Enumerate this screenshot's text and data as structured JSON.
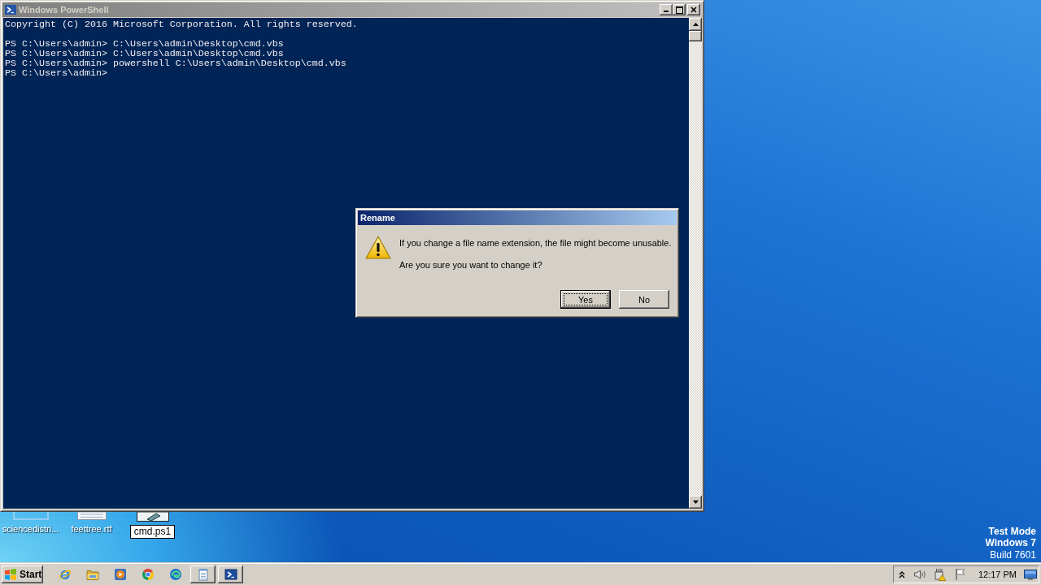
{
  "window": {
    "title": "Windows PowerShell",
    "active": false,
    "console": {
      "header": "Copyright (C) 2016 Microsoft Corporation. All rights reserved.",
      "lines": [
        "PS C:\\Users\\admin> C:\\Users\\admin\\Desktop\\cmd.vbs",
        "PS C:\\Users\\admin> C:\\Users\\admin\\Desktop\\cmd.vbs",
        "PS C:\\Users\\admin> powershell C:\\Users\\admin\\Desktop\\cmd.vbs",
        "PS C:\\Users\\admin>"
      ]
    }
  },
  "dialog": {
    "title": "Rename",
    "active": true,
    "message": "If you change a file name extension, the file might become unusable.",
    "question": "Are you sure you want to change it?",
    "buttons": [
      {
        "label": "Yes",
        "default": true
      },
      {
        "label": "No",
        "default": false
      }
    ]
  },
  "desktop": {
    "icons": [
      {
        "label": "sciencedistri...",
        "kind": "thumbnail",
        "editing": false
      },
      {
        "label": "feettree.rtf",
        "kind": "document",
        "editing": false
      },
      {
        "label": "cmd.ps1",
        "kind": "script",
        "editing": true
      }
    ],
    "edition": {
      "mode": "Test Mode",
      "os": "Windows 7",
      "build": "Build 7601"
    }
  },
  "taskbar": {
    "start": "Start",
    "pinned": [
      {
        "kind": "globe"
      },
      {
        "kind": "folder"
      },
      {
        "kind": "player"
      },
      {
        "kind": "tricolor"
      },
      {
        "kind": "wave"
      }
    ],
    "windows": [
      {
        "kind": "notepad"
      },
      {
        "kind": "console"
      }
    ],
    "tray": {
      "icons": [
        {
          "kind": "chevron"
        },
        {
          "kind": "speaker"
        },
        {
          "kind": "network"
        },
        {
          "kind": "flag"
        }
      ],
      "clock": "12:17 PM"
    }
  }
}
